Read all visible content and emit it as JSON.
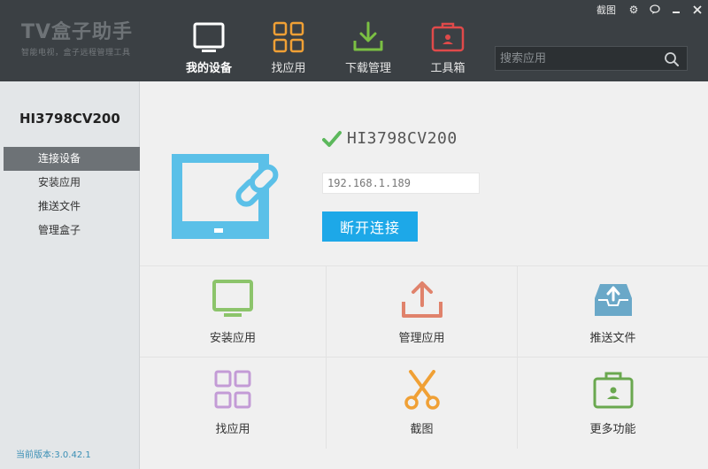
{
  "header": {
    "logo_title": "TV盒子助手",
    "logo_subtitle": "智能电视，盒子远程管理工具",
    "nav": [
      {
        "label": "我的设备",
        "icon": "tv-screen-icon",
        "color": "#ffffff"
      },
      {
        "label": "找应用",
        "icon": "grid-apps-icon",
        "color": "#f0a035"
      },
      {
        "label": "下载管理",
        "icon": "download-icon",
        "color": "#7bc043"
      },
      {
        "label": "工具箱",
        "icon": "toolbox-icon",
        "color": "#e04a4a"
      }
    ],
    "screenshot_label": "截图",
    "window_controls": [
      "settings-icon",
      "feedback-icon",
      "minimize-icon",
      "close-icon"
    ],
    "search_placeholder": "搜索应用"
  },
  "sidebar": {
    "device_name": "HI3798CV200",
    "items": [
      {
        "label": "连接设备"
      },
      {
        "label": "安装应用"
      },
      {
        "label": "推送文件"
      },
      {
        "label": "管理盒子"
      }
    ],
    "version": "当前版本:3.0.42.1"
  },
  "main": {
    "status_name": "HI3798CV200",
    "ip": "192.168.1.189",
    "disconnect_label": "断开连接",
    "actions": [
      {
        "label": "安装应用",
        "icon": "monitor-icon",
        "color": "#8cc46b"
      },
      {
        "label": "管理应用",
        "icon": "upload-icon",
        "color": "#e0826b"
      },
      {
        "label": "推送文件",
        "icon": "inbox-upload-icon",
        "color": "#6aa8c8"
      },
      {
        "label": "找应用",
        "icon": "grid-apps-icon",
        "color": "#c39bd6"
      },
      {
        "label": "截图",
        "icon": "scissors-icon",
        "color": "#f0a035"
      },
      {
        "label": "更多功能",
        "icon": "toolbox-icon",
        "color": "#6aa84f"
      }
    ]
  },
  "colors": {
    "header_bg": "#3b4044",
    "accent": "#1da8e8",
    "check": "#5cb85c",
    "sidebar_active": "#6d7276"
  }
}
